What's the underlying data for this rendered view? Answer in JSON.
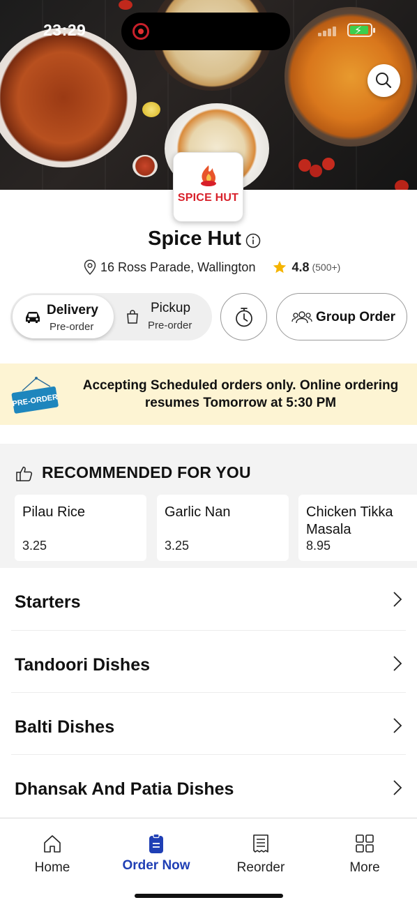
{
  "status_bar": {
    "time": "23:29"
  },
  "restaurant": {
    "logo_text": "SPICE HUT",
    "name": "Spice Hut",
    "address": "16 Ross Parade, Wallington",
    "rating": "4.8",
    "rating_count": "(500+)"
  },
  "order_modes": {
    "delivery": {
      "label": "Delivery",
      "sub": "Pre-order",
      "selected": true
    },
    "pickup": {
      "label": "Pickup",
      "sub": "Pre-order",
      "selected": false
    },
    "group_order_label": "Group Order"
  },
  "notice": {
    "badge_text": "PRE-ORDER",
    "message": "Accepting Scheduled orders only. Online ordering resumes Tomorrow at 5:30 PM",
    "background": "#fdf4d3"
  },
  "recommended": {
    "title": "RECOMMENDED FOR YOU",
    "items": [
      {
        "name": "Pilau Rice",
        "price": "3.25"
      },
      {
        "name": "Garlic Nan",
        "price": "3.25"
      },
      {
        "name": "Chicken Tikka Masala",
        "price": "8.95"
      }
    ]
  },
  "categories": [
    {
      "label": "Starters"
    },
    {
      "label": "Tandoori Dishes"
    },
    {
      "label": "Balti Dishes"
    },
    {
      "label": "Dhansak And Patia Dishes"
    }
  ],
  "tabs": [
    {
      "label": "Home",
      "icon": "home-icon",
      "active": false
    },
    {
      "label": "Order Now",
      "icon": "order-icon",
      "active": true
    },
    {
      "label": "Reorder",
      "icon": "receipt-icon",
      "active": false
    },
    {
      "label": "More",
      "icon": "grid-icon",
      "active": false
    }
  ],
  "colors": {
    "accent": "#1f3fb5",
    "brand_red": "#d8202a",
    "star": "#f5b400",
    "notice_bg": "#fdf4d3",
    "recommended_bg": "#f3f3f3"
  }
}
